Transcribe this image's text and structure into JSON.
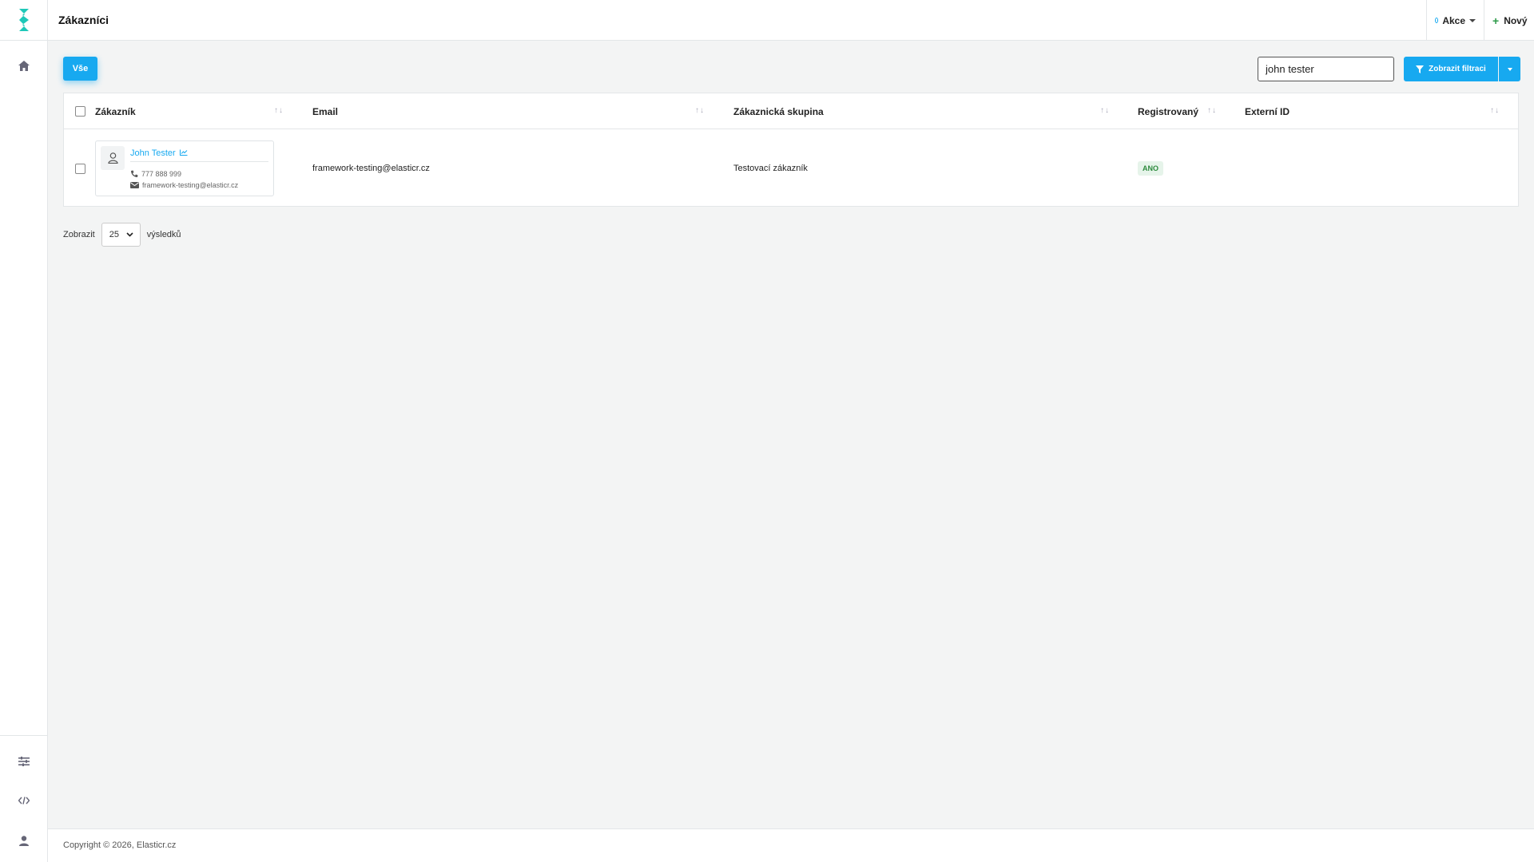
{
  "header": {
    "title": "Zákazníci",
    "actions_label": "Akce",
    "new_label": "Nový"
  },
  "sidebar": {
    "icons": [
      "home-icon",
      "sliders-icon",
      "code-icon",
      "user-icon"
    ]
  },
  "toolbar": {
    "tab_all": "Vše",
    "search_value": "john tester",
    "filter_button": "Zobrazit filtraci"
  },
  "table": {
    "columns": [
      "Zákazník",
      "Email",
      "Zákaznická skupina",
      "Registrovaný",
      "Externí ID"
    ],
    "rows": [
      {
        "customer": {
          "name": "John Tester",
          "phone": "777 888 999",
          "email": "framework-testing@elasticr.cz"
        },
        "email": "framework-testing@elasticr.cz",
        "group": "Testovací zákazník",
        "registered": "ANO",
        "external_id": ""
      }
    ]
  },
  "pager": {
    "show_label": "Zobrazit",
    "per_page": "25",
    "results_label": "výsledků"
  },
  "footer": {
    "copyright": "Copyright © 2026, Elasticr.cz"
  },
  "colors": {
    "accent": "#17a9f0",
    "brand": "#1ec8b8",
    "badge_bg": "#e6f4ea",
    "badge_text": "#2e8b3e"
  }
}
